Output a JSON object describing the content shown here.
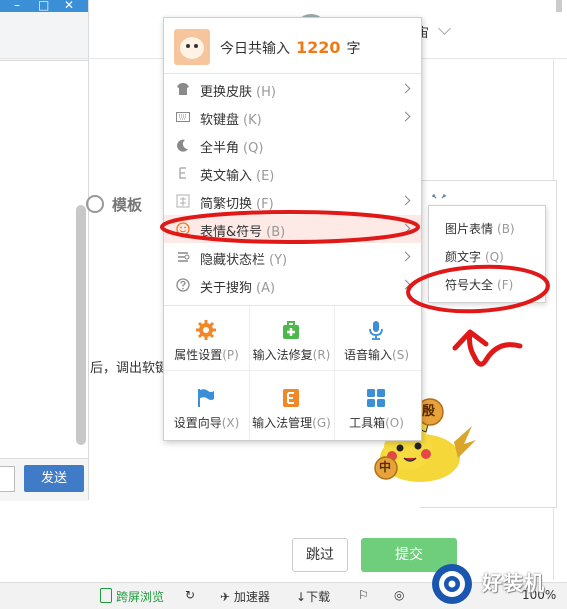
{
  "background": {
    "send_button": "发送",
    "partial_text": "后，调出软键",
    "template_label": "模板",
    "header_char": "宙",
    "skip_button": "跳过",
    "submit_button": "提交",
    "expand_icon": "expand-icon"
  },
  "statusbar": {
    "split_browse": "跨屏浏览",
    "accelerator": "加速器",
    "download": "下载",
    "zoom": "100%"
  },
  "menu": {
    "header_prefix": "今日共输入",
    "header_count": "1220",
    "header_suffix": "字",
    "items": [
      {
        "label": "更换皮肤",
        "shortcut": "(H)",
        "icon": "shirt-icon",
        "arrow": true
      },
      {
        "label": "软键盘",
        "shortcut": "(K)",
        "icon": "keyboard-icon",
        "arrow": true
      },
      {
        "label": "全半角",
        "shortcut": "(Q)",
        "icon": "moon-icon",
        "arrow": false
      },
      {
        "label": "英文输入",
        "shortcut": "(E)",
        "icon": "english-icon",
        "arrow": false
      },
      {
        "label": "简繁切换",
        "shortcut": "(F)",
        "icon": "simplified-icon",
        "arrow": true
      },
      {
        "label": "表情&符号",
        "shortcut": "(B)",
        "icon": "smiley-icon",
        "arrow": true
      },
      {
        "label": "隐藏状态栏",
        "shortcut": "(Y)",
        "icon": "hide-statusbar-icon",
        "arrow": true
      },
      {
        "label": "关于搜狗",
        "shortcut": "(A)",
        "icon": "question-icon",
        "arrow": true
      }
    ],
    "grid": [
      {
        "label": "属性设置",
        "shortcut": "(P)",
        "icon": "gear-icon",
        "color": "#f0882a"
      },
      {
        "label": "输入法修复",
        "shortcut": "(R)",
        "icon": "repair-kit-icon",
        "color": "#4cb84c"
      },
      {
        "label": "语音输入",
        "shortcut": "(S)",
        "icon": "microphone-icon",
        "color": "#3b8fd6"
      },
      {
        "label": "设置向导",
        "shortcut": "(X)",
        "icon": "flag-icon",
        "color": "#3b8fd6"
      },
      {
        "label": "输入法管理",
        "shortcut": "(G)",
        "icon": "ime-manager-icon",
        "color": "#f0882a"
      },
      {
        "label": "工具箱",
        "shortcut": "(O)",
        "icon": "toolbox-icon",
        "color": "#3b8fd6"
      }
    ]
  },
  "submenu": {
    "items": [
      {
        "label": "图片表情",
        "shortcut": "(B)"
      },
      {
        "label": "颜文字",
        "shortcut": "(Q)"
      },
      {
        "label": "符号大全",
        "shortcut": "(F)"
      }
    ]
  },
  "mascot": {
    "char1": "殷",
    "char2": "中"
  },
  "watermark": {
    "text": "好装机"
  },
  "colors": {
    "accent_orange": "#f07a16",
    "annotation_red": "#e01818",
    "submit_green": "#6fce7b",
    "send_blue": "#3f7bc6"
  }
}
